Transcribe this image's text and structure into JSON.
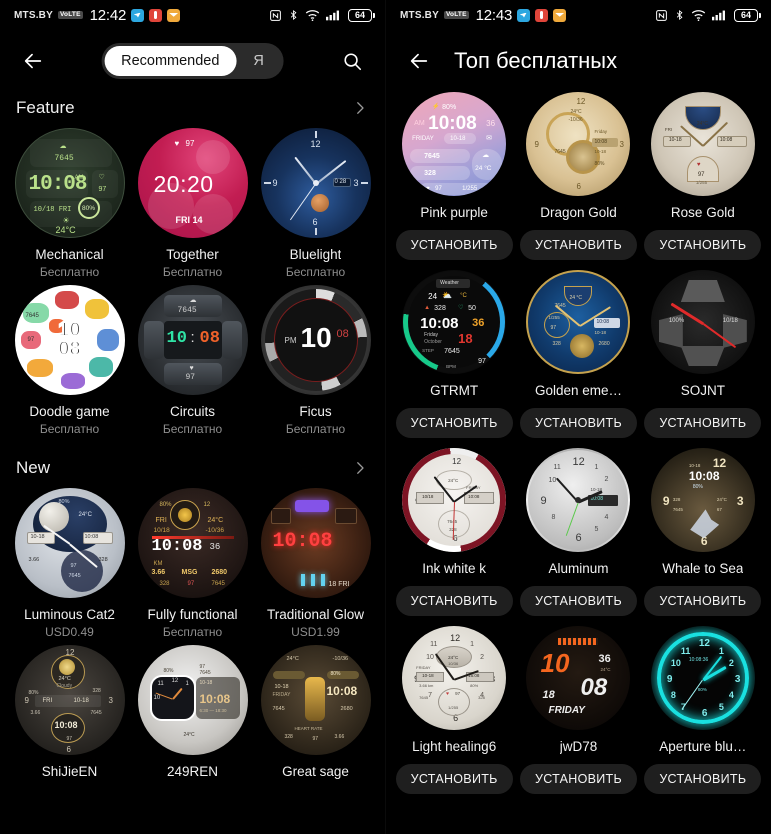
{
  "left_screen": {
    "status_bar": {
      "carrier": "MTS.BY",
      "network_badge": "VoLTE",
      "time": "12:42",
      "battery": "64",
      "app_icons": [
        "telegram-icon",
        "reddit-icon",
        "mail-icon"
      ],
      "right_icons": [
        "nfc-icon",
        "bluetooth-icon",
        "wifi-icon",
        "signal-icon",
        "battery-icon"
      ]
    },
    "appbar": {
      "back": "back-arrow",
      "segments": [
        {
          "label": "Recommended",
          "active": true
        },
        {
          "label": "Я",
          "active": false
        }
      ],
      "search": "search-icon"
    },
    "sections": [
      {
        "title": "Feature",
        "more": "chevron-right-icon",
        "items": [
          {
            "name": "Mechanical",
            "price": "Бесплатно",
            "art": "mech"
          },
          {
            "name": "Together",
            "price": "Бесплатно",
            "art": "tog"
          },
          {
            "name": "Bluelight",
            "price": "Бесплатно",
            "art": "blue"
          },
          {
            "name": "Doodle game",
            "price": "Бесплатно",
            "art": "doodle"
          },
          {
            "name": "Circuits",
            "price": "Бесплатно",
            "art": "circ"
          },
          {
            "name": "Ficus",
            "price": "Бесплатно",
            "art": "ficus"
          }
        ]
      },
      {
        "title": "New",
        "more": "chevron-right-icon",
        "items": [
          {
            "name": "Luminous Cat2",
            "price": "USD0.49",
            "art": "lum"
          },
          {
            "name": "Fully functional",
            "price": "Бесплатно",
            "art": "fully"
          },
          {
            "name": "Traditional Glow",
            "price": "USD1.99",
            "art": "trad"
          },
          {
            "name": "ShiJieEN",
            "price": "",
            "art": "shi"
          },
          {
            "name": "249REN",
            "price": "",
            "art": "ren"
          },
          {
            "name": "Great sage",
            "price": "",
            "art": "sage"
          }
        ]
      }
    ]
  },
  "right_screen": {
    "status_bar": {
      "carrier": "MTS.BY",
      "network_badge": "VoLTE",
      "time": "12:43",
      "battery": "64",
      "app_icons": [
        "telegram-icon",
        "reddit-icon",
        "mail-icon"
      ],
      "right_icons": [
        "nfc-icon",
        "bluetooth-icon",
        "wifi-icon",
        "signal-icon",
        "battery-icon"
      ]
    },
    "appbar": {
      "back": "back-arrow",
      "title": "Топ бесплатных"
    },
    "install_label": "УСТАНОВИТЬ",
    "items": [
      {
        "name": "Pink purple",
        "art": "pink",
        "install": "УСТАНОВИТЬ"
      },
      {
        "name": "Dragon Gold",
        "art": "dgold",
        "install": "УСТАНОВИТЬ"
      },
      {
        "name": "Rose Gold",
        "art": "rgold",
        "install": "УСТАНОВИТЬ"
      },
      {
        "name": "GTRMT",
        "art": "gtr",
        "install": "УСТАНОВИТЬ"
      },
      {
        "name": "Golden eme…",
        "art": "gemer",
        "install": "УСТАНОВИТЬ"
      },
      {
        "name": "SOJNT",
        "art": "sojnt",
        "install": "УСТАНОВИТЬ"
      },
      {
        "name": "Ink white k",
        "art": "inkw",
        "install": "УСТАНОВИТЬ"
      },
      {
        "name": "Aluminum",
        "art": "alum",
        "install": "УСТАНОВИТЬ"
      },
      {
        "name": "Whale to Sea",
        "art": "whale",
        "install": "УСТАНОВИТЬ"
      },
      {
        "name": "Light healing6",
        "art": "lhea",
        "install": "УСТАНОВИТЬ"
      },
      {
        "name": "jwD78",
        "art": "jwd",
        "install": "УСТАНОВИТЬ"
      },
      {
        "name": "Aperture blu…",
        "art": "aper",
        "install": "УСТАНОВИТЬ"
      }
    ]
  },
  "face_art_text": {
    "mech": {
      "time": "10:08",
      "ampm": "AM",
      "steps": "7645",
      "hr": "97",
      "date": "10/18  FRI",
      "temp": "24°C",
      "batt": "80%"
    },
    "tog": {
      "time": "20:20",
      "hr": "97",
      "date": "FRI 14"
    },
    "blue": {
      "n12": "12",
      "n3": "3",
      "n6": "6",
      "n9": "9",
      "date": "0  28"
    },
    "doodle": {
      "l1": "10",
      "l2": "08",
      "steps": "7645",
      "hr": "97"
    },
    "circ": {
      "h": "10",
      "m": "08",
      "steps": "7645",
      "hr": "97"
    },
    "ficus": {
      "ampm": "PM",
      "h": "10",
      "m": "08"
    },
    "lum": {
      "time": "10:08",
      "date": "10-18",
      "batt": "80%",
      "temp": "24°C",
      "steps": "7645",
      "hr": "97",
      "cal": "328",
      "km": "3.66"
    },
    "fully": {
      "time": "10:08",
      "sec": "36",
      "date": "10/18",
      "day": "FRI",
      "temp": "24°C",
      "batt": "80%",
      "km": "3.66",
      "msg": "MSG",
      "m": "2680",
      "cal": "328",
      "hr": "97",
      "steps": "7645"
    },
    "trad": {
      "time": "10:08",
      "date": "18  FRI"
    },
    "shi": {
      "time": "10:08",
      "temp": "24°C",
      "cond": "Cloudy",
      "date": "10-18",
      "day": "FRI",
      "steps": "7645",
      "cal": "328",
      "batt": "80%",
      "km": "3.66",
      "hr": "97"
    },
    "ren": {
      "time": "10:08",
      "date": "10-18",
      "range": "6:30 — 18:30",
      "temp": "24°C",
      "batt": "80%",
      "hr": "97",
      "steps": "7645"
    },
    "sage": {
      "time": "10:08",
      "temp": "24°C",
      "date": "10-18",
      "day": "FRIDAY",
      "batt": "80%",
      "steps": "7645",
      "m": "2680",
      "cal": "328",
      "km": "3.66",
      "hr": "97",
      "label": "HEART RATE"
    },
    "pink": {
      "time": "10:08",
      "ampm": "AM",
      "sec": "36",
      "batt": "80%",
      "day": "FRIDAY",
      "date": "10-18",
      "steps": "7645",
      "cal": "328",
      "temp": "24 °C",
      "hr": "97",
      "hrrange": "1/255"
    },
    "dgold": {
      "time": "10:08",
      "temp": "24°C",
      "date": "10-18",
      "day": "Friday",
      "batt": "80%",
      "steps": "7645",
      "n12": "12",
      "n3": "3",
      "n6": "6",
      "n9": "9"
    },
    "rgold": {
      "time": "10:08",
      "temp": "24°C",
      "date": "10-18",
      "day": "FRI",
      "hr": "97",
      "sub": "1/255"
    },
    "gtr": {
      "time": "10:08",
      "sec": "36",
      "temp": "24",
      "unit": "°C",
      "cal": "328",
      "bpm2": "50",
      "day": "Friday",
      "month": "October",
      "date": "18",
      "steps": "7645",
      "hr": "97",
      "stepLabel": "STEP",
      "bpmLabel": "BPM",
      "weather": "Weather"
    },
    "gemer": {
      "time": "10:08",
      "temp": "24 °C",
      "date": "10-18",
      "steps": "7645",
      "hr": "97",
      "cal": "328",
      "m": "2680",
      "sub": "1/255"
    },
    "sojnt": {
      "batt": "100%",
      "date": "10/18"
    },
    "inkw": {
      "time": "10:08",
      "temp": "24°C",
      "date": "10/18",
      "day": "FRIDAY",
      "steps": "7645",
      "cal": "328"
    },
    "alum": {
      "time": "10:08",
      "date": "10-18",
      "day": "FRI"
    },
    "whale": {
      "time": "10:08",
      "batt": "80%",
      "temp": "24°C",
      "steps": "328",
      "step2": "7645",
      "hr": "67",
      "date": "10-18",
      "n12": "12",
      "n3": "3",
      "n6": "6",
      "n9": "9"
    },
    "lhea": {
      "time": "16:08",
      "temp": "24°C",
      "date": "10-18",
      "day": "FRIDAY",
      "km": "3.66 km",
      "batt": "80%",
      "hr": "97",
      "steps": "7645",
      "cal": "328",
      "sub": "1/255"
    },
    "jwd": {
      "h": "10",
      "m": "08",
      "sec": "36",
      "date": "18",
      "day": "FRIDAY",
      "temp": "24°C"
    },
    "aper": {
      "time": "10:08:36",
      "batt": "80%",
      "n12": "12",
      "n3": "3",
      "n6": "6",
      "n9": "9"
    }
  },
  "colors": {
    "background": "#000000",
    "segment_track": "#2b2b2b",
    "segment_active_bg": "#ffffff",
    "install_button_bg": "#1f1f1f",
    "primary_text": "#f2f2f2",
    "secondary_text": "#8e8e8e"
  }
}
